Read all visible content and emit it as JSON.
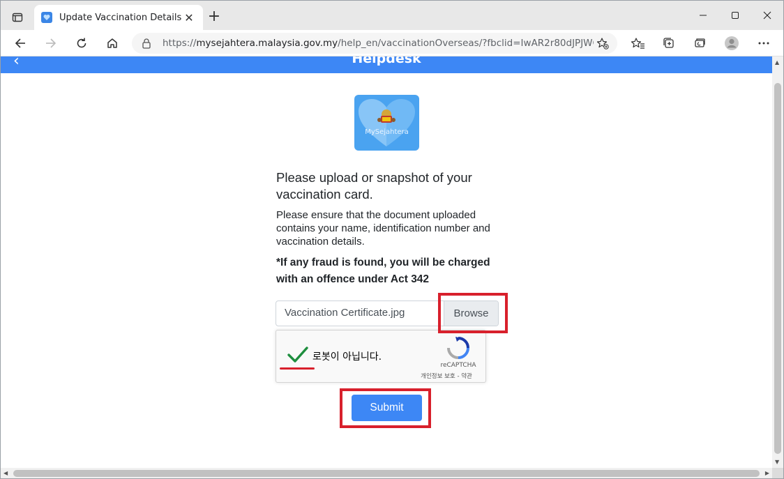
{
  "browser": {
    "tab_title": "Update Vaccination Details",
    "tab_close": "✕",
    "new_tab": "+",
    "url_prefix": "https://",
    "url_host": "mysejahtera.malaysia.gov.my",
    "url_path": "/help_en/vaccinationOverseas/?fbclid=IwAR2r80dJPJWGVpt9...",
    "window_controls": [
      "minimize-icon",
      "maximize-icon",
      "close-icon"
    ],
    "toolbar_icons": [
      "back-icon",
      "forward-icon",
      "refresh-icon",
      "home-icon",
      "lock-icon",
      "add-favorite-icon",
      "favorites-icon",
      "collections-icon",
      "performance-icon",
      "profile-icon",
      "more-icon"
    ]
  },
  "page": {
    "header_title": "Helpdesk",
    "header_back": "‹",
    "logo_text": "MySejahtera",
    "heading": "Please upload or snapshot of your vaccination card.",
    "instructions": "Please ensure that the document uploaded contains your name, identification number and vaccination details.",
    "warning": "*If any fraud is found, you will be charged with an offence under Act 342",
    "file_input_value": "Vaccination Certificate.jpg",
    "browse_label": "Browse",
    "recaptcha": {
      "label": "로봇이 아닙니다.",
      "brand": "reCAPTCHA",
      "links": "개인정보 보호 - 약관",
      "checked": true
    },
    "submit_label": "Submit"
  },
  "colors": {
    "accent": "#3d87f5",
    "highlight": "#d8202c",
    "check": "#1e8e3e"
  }
}
